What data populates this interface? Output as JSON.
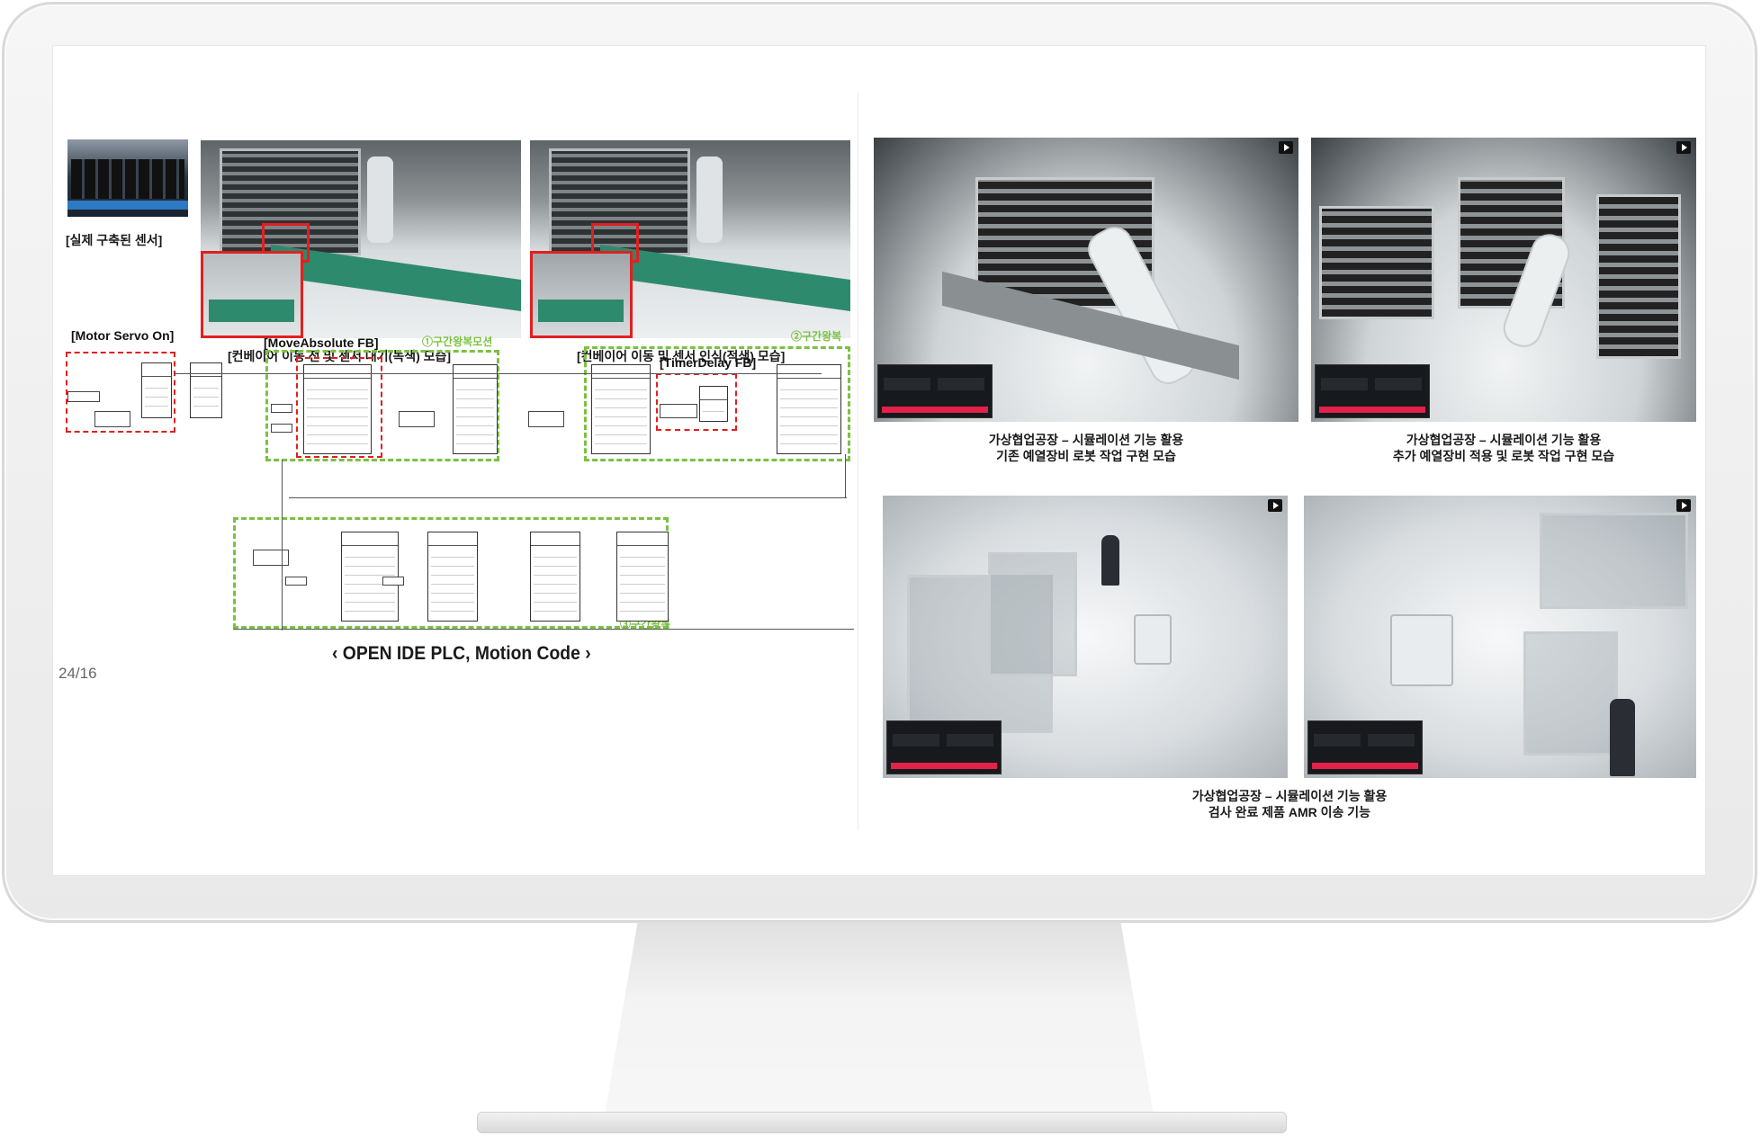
{
  "left": {
    "sensor_caption": "[실제 구축된 센서]",
    "conveyor_before_caption": "[컨베이어 이동 전 및 센서 대기(녹색) 모습]",
    "conveyor_after_caption": "[컨베이어 이동 및 센서 인식(적색) 모습]",
    "plc": {
      "motor_servo_label": "[Motor Servo On]",
      "move_absolute_label": "[MoveAbsolute FB]",
      "timer_delay_label": "[TimerDelay FB]",
      "section1_label": "①구간왕복모션",
      "section2_label": "②구간왕복",
      "section3_label": "③구간왕복"
    },
    "code_caption": "‹ OPEN IDE PLC, Motion Code ›",
    "page_number": "24/16"
  },
  "right": {
    "caption1_line1": "가상협업공장 – 시뮬레이션 기능 활용",
    "caption1_line2": "기존 예열장비 로봇 작업 구현 모습",
    "caption2_line1": "가상협업공장 – 시뮬레이션 기능 활용",
    "caption2_line2": "추가 예열장비 적용 및  로봇 작업 구현 모습",
    "caption3_line1": "가상협업공장 – 시뮬레이션 기능 활용",
    "caption3_line2": "검사 완료 제품 AMR 이송 기능"
  },
  "colors": {
    "highlight_red": "#e02020",
    "section_green": "#7ac142",
    "conveyor_green": "#2e8a6c",
    "hud_button": "#e3214a"
  }
}
